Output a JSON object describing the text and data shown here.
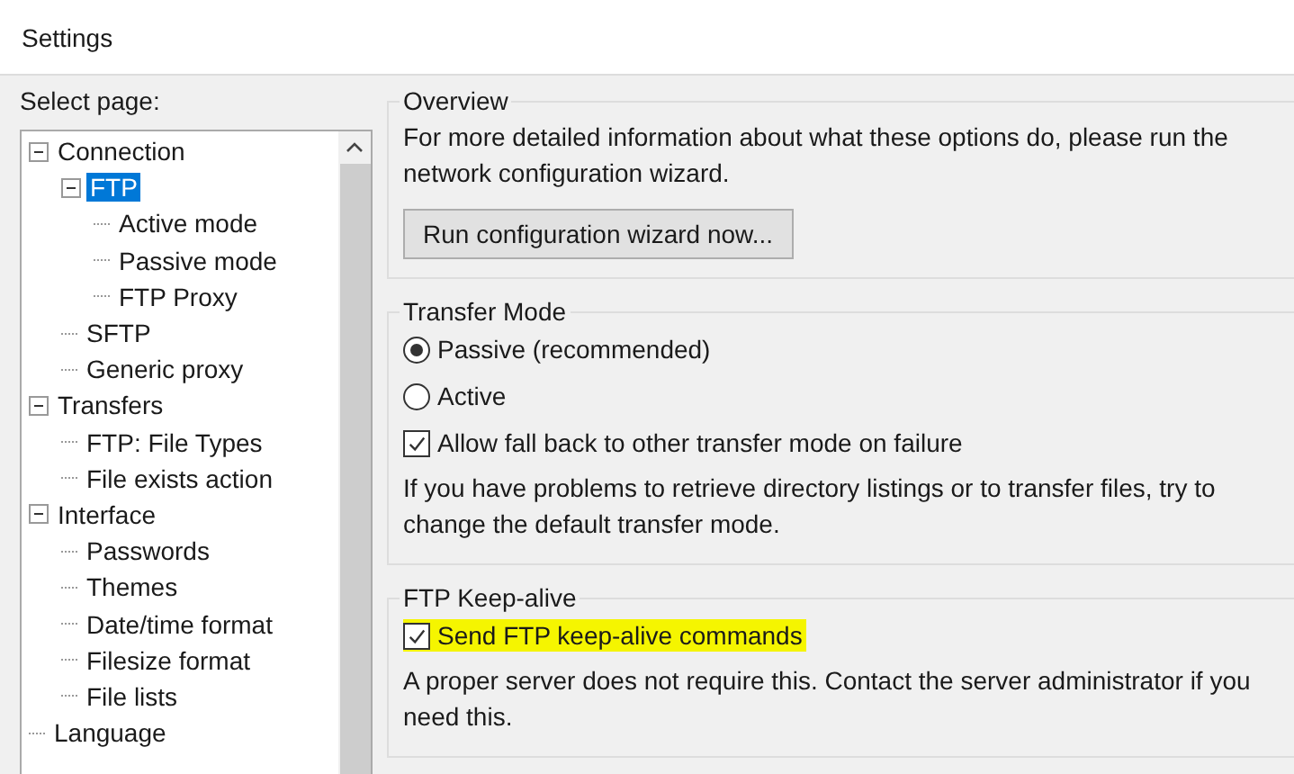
{
  "window": {
    "title": "Settings"
  },
  "sidebar": {
    "label": "Select page:",
    "tree": [
      {
        "label": "Connection",
        "expanded": true,
        "selected": false,
        "children": [
          {
            "label": "FTP",
            "expanded": true,
            "selected": true,
            "children": [
              {
                "label": "Active mode",
                "selected": false
              },
              {
                "label": "Passive mode",
                "selected": false
              },
              {
                "label": "FTP Proxy",
                "selected": false
              }
            ]
          },
          {
            "label": "SFTP",
            "selected": false
          },
          {
            "label": "Generic proxy",
            "selected": false
          }
        ]
      },
      {
        "label": "Transfers",
        "expanded": true,
        "selected": false,
        "children": [
          {
            "label": "FTP: File Types",
            "selected": false
          },
          {
            "label": "File exists action",
            "selected": false
          }
        ]
      },
      {
        "label": "Interface",
        "expanded": true,
        "selected": false,
        "children": [
          {
            "label": "Passwords",
            "selected": false
          },
          {
            "label": "Themes",
            "selected": false
          },
          {
            "label": "Date/time format",
            "selected": false
          },
          {
            "label": "Filesize format",
            "selected": false
          },
          {
            "label": "File lists",
            "selected": false
          }
        ]
      },
      {
        "label": "Language",
        "selected": false
      }
    ]
  },
  "groups": [
    {
      "title": "Overview",
      "items": [
        {
          "kind": "text",
          "text": "For more detailed information about what these options do, please run the network configuration wizard."
        },
        {
          "kind": "button",
          "text": "Run configuration wizard now..."
        }
      ]
    },
    {
      "title": "Transfer Mode",
      "items": [
        {
          "kind": "radio",
          "text": "Passive (recommended)",
          "selected": true
        },
        {
          "kind": "radio",
          "text": "Active",
          "selected": false
        },
        {
          "kind": "checkbox",
          "text": "Allow fall back to other transfer mode on failure",
          "checked": true,
          "highlighted": false
        },
        {
          "kind": "text",
          "text": "If you have problems to retrieve directory listings or to transfer files, try to change the default transfer mode."
        }
      ]
    },
    {
      "title": "FTP Keep-alive",
      "items": [
        {
          "kind": "checkbox",
          "text": "Send FTP keep-alive commands",
          "checked": true,
          "highlighted": true
        },
        {
          "kind": "text",
          "text": "A proper server does not require this. Contact the server administrator if you need this."
        }
      ]
    }
  ]
}
